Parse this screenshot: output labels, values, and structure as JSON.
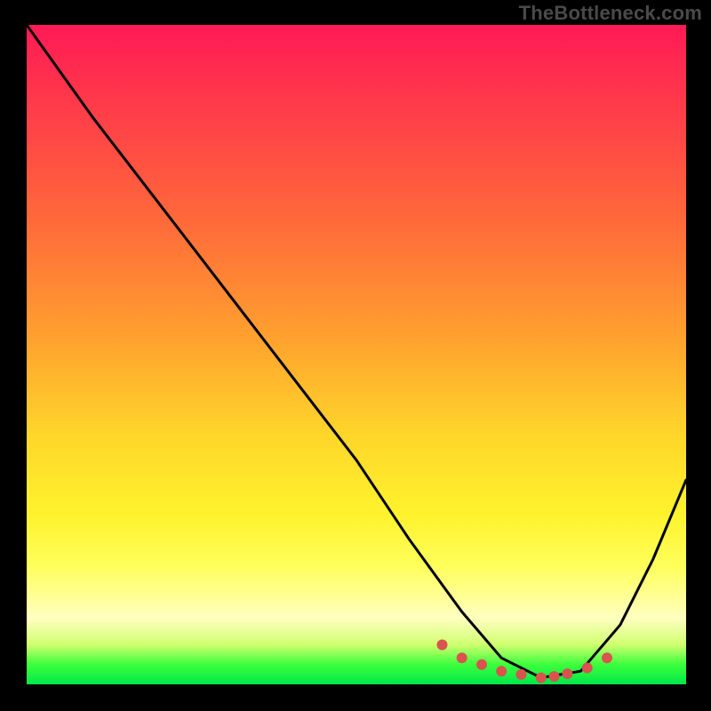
{
  "watermark": "TheBottleneck.com",
  "chart_data": {
    "type": "line",
    "title": "",
    "xlabel": "",
    "ylabel": "",
    "xlim": [
      0,
      100
    ],
    "ylim": [
      0,
      100
    ],
    "series": [
      {
        "name": "bottleneck-curve",
        "x": [
          0,
          10,
          20,
          30,
          40,
          50,
          58,
          66,
          72,
          78,
          84,
          90,
          95,
          100
        ],
        "values": [
          100,
          86,
          73,
          60,
          47,
          34,
          22,
          11,
          4,
          1,
          2,
          9,
          19,
          31
        ]
      }
    ],
    "markers": {
      "name": "highlight-dots",
      "x": [
        63,
        66,
        69,
        72,
        75,
        78,
        80,
        82,
        85,
        88
      ],
      "values": [
        6,
        4,
        3,
        2,
        1.5,
        1,
        1.2,
        1.6,
        2.5,
        4
      ],
      "color": "#d9534f"
    },
    "gradient_stops": [
      {
        "pos": 0,
        "color": "#ff1a55"
      },
      {
        "pos": 30,
        "color": "#ff6a3a"
      },
      {
        "pos": 62,
        "color": "#ffd52a"
      },
      {
        "pos": 90,
        "color": "#ffffc0"
      },
      {
        "pos": 100,
        "color": "#00e84a"
      }
    ]
  }
}
